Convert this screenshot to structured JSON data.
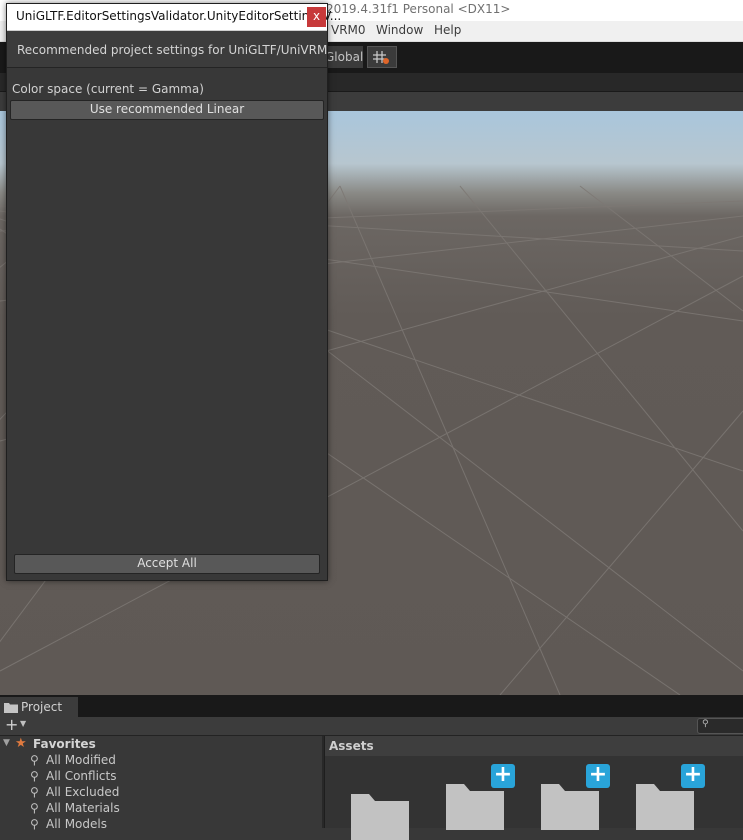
{
  "window": {
    "title": "2019.4.31f1 Personal <DX11>"
  },
  "menubar": {
    "items": [
      "VRM0",
      "Window",
      "Help"
    ]
  },
  "toolbar": {
    "pivot_label": "Global"
  },
  "dialog": {
    "title": "UniGLTF.EditorSettingsValidator.UnityEditorSettingsV...",
    "close_label": "x",
    "header": "Recommended project settings for UniGLTF/UniVRM",
    "color_space_label": "Color space (current = Gamma)",
    "use_linear_label": "Use recommended Linear",
    "accept_all_label": "Accept All"
  },
  "project_panel": {
    "tab_label": "Project",
    "add_label": "+",
    "favorites_label": "Favorites",
    "favorites": [
      "All Modified",
      "All Conflicts",
      "All Excluded",
      "All Materials",
      "All Models"
    ],
    "assets_label": "Assets"
  },
  "colors": {
    "dialog_bg": "#383838",
    "close_red": "#c7393a",
    "plus_blue": "#29a4d9",
    "favorite_star": "#e07a3f"
  }
}
